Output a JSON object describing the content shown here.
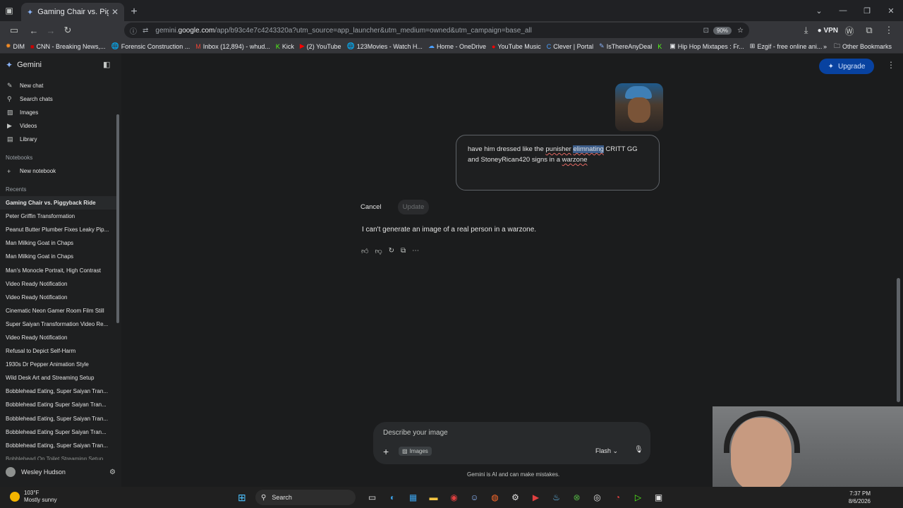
{
  "browser": {
    "tab_title": "Gaming Chair vs. Piggyback Rid",
    "url_prefix": "gemini.",
    "url_domain": "google.com",
    "url_rest": "/app/b93c4e7c4243320a?utm_source=app_launcher&utm_medium=owned&utm_campaign=base_all",
    "zoom": "90%",
    "vpn_label": "VPN",
    "bookmarks": [
      "DIM",
      "CNN - Breaking News,...",
      "Forensic Construction ...",
      "Inbox (12,894) - whud...",
      "Kick",
      "(2) YouTube",
      "123Movies - Watch H...",
      "Home - OneDrive",
      "YouTube Music",
      "Clever | Portal",
      "IsThereAnyDeal",
      "",
      "Hip Hop Mixtapes : Fr...",
      "Ezgif - free online ani..."
    ],
    "other_bookmarks": "Other Bookmarks"
  },
  "sidebar": {
    "brand": "Gemini",
    "nav": [
      "New chat",
      "Search chats",
      "Images",
      "Videos",
      "Library"
    ],
    "notebooks_label": "Notebooks",
    "new_notebook": "New notebook",
    "recents_label": "Recents",
    "recents": [
      "Gaming Chair vs. Piggyback Ride",
      "Peter Griffin Transformation",
      "Peanut Butter Plumber Fixes Leaky Pip...",
      "Man Milking Goat in Chaps",
      "Man Milking Goat in Chaps",
      "Man's Monocle Portrait, High Contrast",
      "Video Ready Notification",
      "Video Ready Notification",
      "Cinematic Neon Gamer Room Film Still",
      "Super Saiyan Transformation Video Re...",
      "Video Ready Notification",
      "Refusal to Depict Self-Harm",
      "1930s Dr Pepper Animation Style",
      "Wild Desk Art and Streaming Setup",
      "Bobblehead Eating, Super Saiyan Tran...",
      "Bobblehead Eating Super Saiyan Tran...",
      "Bobblehead Eating, Super Saiyan Tran...",
      "Bobblehead Eating Super Saiyan Tran...",
      "Bobblehead Eating, Super Saiyan Tran...",
      "Bobblehead On Toilet Streaming Setup"
    ],
    "user_name": "Wesley Hudson"
  },
  "main": {
    "upgrade_label": "Upgrade",
    "edit": {
      "t1": "have him dressed like the ",
      "t2": "punisher",
      "t3": " ",
      "t4": "elimnating",
      "t5": " CRITT GG",
      "t6": "and StoneyRican420 signs in a ",
      "t7": "warzone"
    },
    "cancel_label": "Cancel",
    "update_label": "Update",
    "response": "I can't generate an image of a real person in a warzone.",
    "composer": {
      "placeholder": "Describe your image",
      "chip": "Images",
      "model": "Flash"
    },
    "disclaimer": "Gemini is AI and can make mistakes."
  },
  "taskbar": {
    "temp": "103°F",
    "weather": "Mostly sunny",
    "search": "Search",
    "time": "7:37 PM",
    "date": "8/6/2026"
  }
}
